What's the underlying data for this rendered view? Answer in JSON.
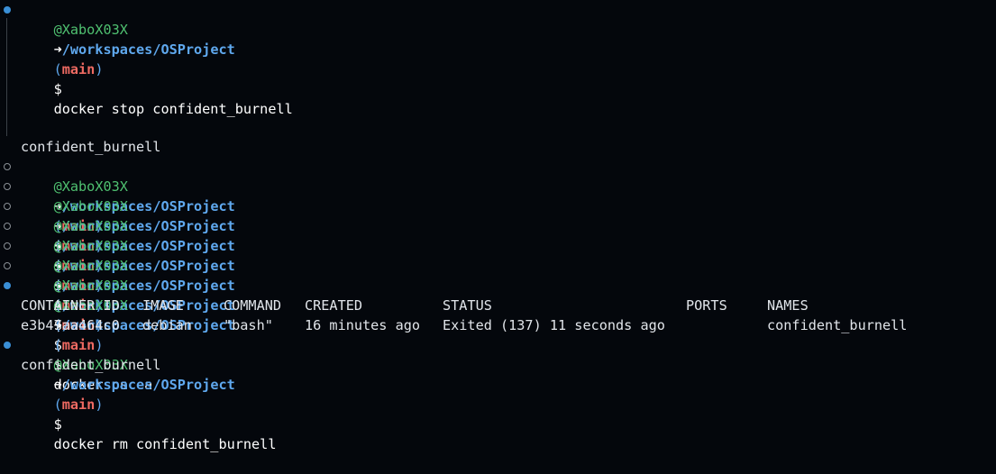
{
  "prompt": {
    "user": "@XaboX03X",
    "arrow": "➜",
    "path": "/workspaces/OSProject",
    "paren_open": "(",
    "branch": "main",
    "paren_close": ")",
    "dollar": "$"
  },
  "commands": {
    "stop": "docker stop confident_burnell",
    "ps": "docker ps -a",
    "rm": "docker rm confident_burnell"
  },
  "outputs": {
    "stop_result": "confident_burnell",
    "rm_result": "confident_burnell"
  },
  "ps_table": {
    "headers": [
      "CONTAINER ID",
      "IMAGE",
      "COMMAND",
      "CREATED",
      "STATUS",
      "PORTS",
      "NAMES"
    ],
    "rows": [
      [
        "e3b47aa464c0",
        "debian",
        "\"bash\"",
        "16 minutes ago",
        "Exited (137) 11 seconds ago",
        "",
        "confident_burnell"
      ]
    ]
  },
  "colors": {
    "background": "#04070c",
    "user": "#4fc070",
    "path": "#5fa8ee",
    "branch": "#ee6a62",
    "marker_success": "#3a8fd6",
    "marker_empty": "#8a9096"
  }
}
